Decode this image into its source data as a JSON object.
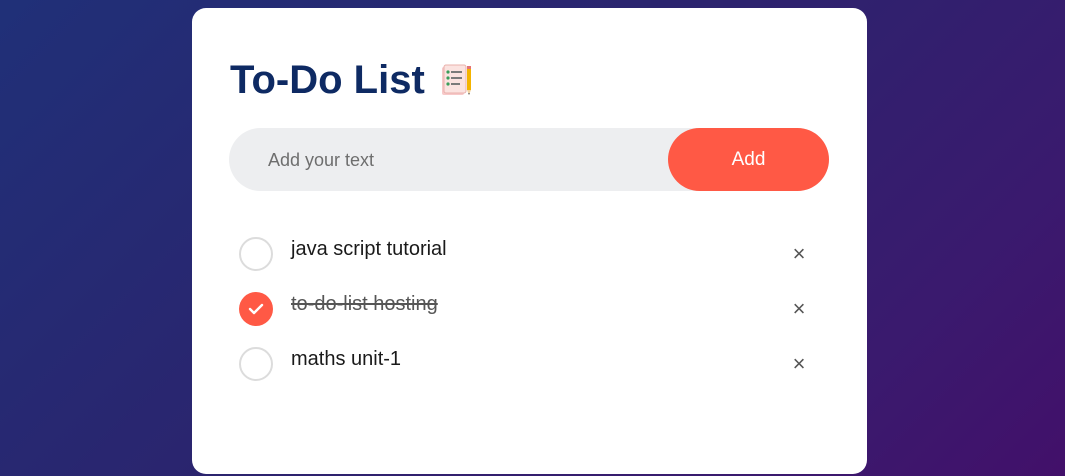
{
  "app": {
    "title": "To-Do List"
  },
  "input": {
    "placeholder": "Add your text",
    "value": ""
  },
  "add_button": {
    "label": "Add"
  },
  "tasks": [
    {
      "text": "java script tutorial",
      "checked": false
    },
    {
      "text": "to-do-list hosting",
      "checked": true
    },
    {
      "text": "maths unit-1",
      "checked": false
    }
  ],
  "icons": {
    "title_icon": "notepad-icon",
    "check": "checkmark-icon",
    "delete": "close-icon",
    "delete_glyph": "×"
  },
  "colors": {
    "accent": "#ff5945",
    "title": "#0e2a63",
    "input_bg": "#edeef0",
    "card_bg": "#ffffff"
  }
}
